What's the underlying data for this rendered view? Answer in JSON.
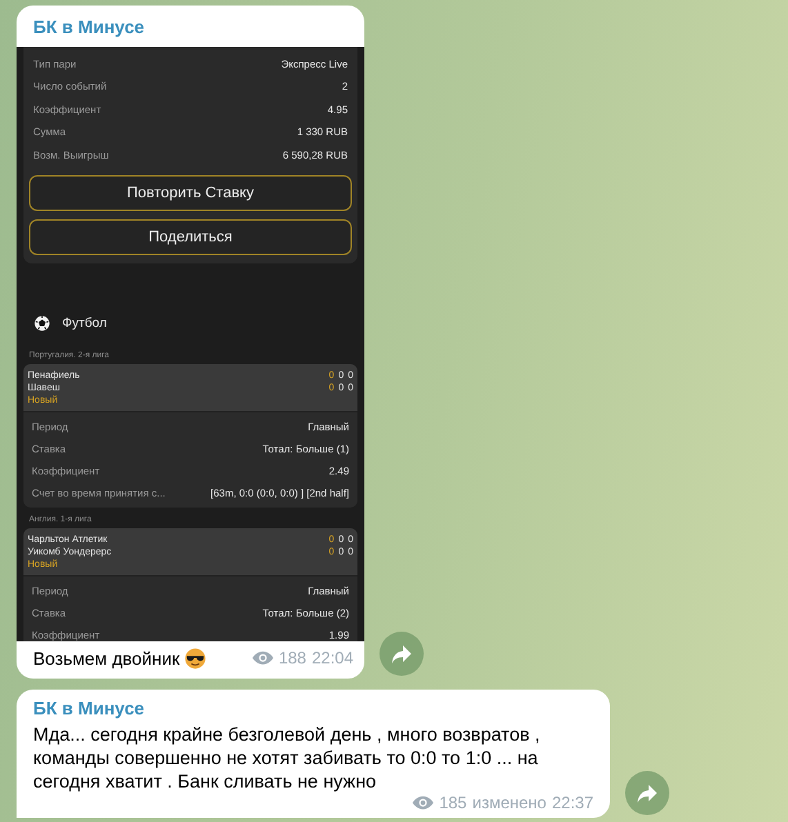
{
  "messages": [
    {
      "kind": "bet",
      "channel": "БК в Минусе",
      "summary": {
        "rows": [
          {
            "label": "Тип пари",
            "value": "Экспресс Live"
          },
          {
            "label": "Число событий",
            "value": "2"
          },
          {
            "label": "Коэффициент",
            "value": "4.95"
          },
          {
            "label": "Сумма",
            "value": "1 330 RUB"
          },
          {
            "label": "Возм. Выигрыш",
            "value": "6 590,28 RUB"
          }
        ],
        "buttons": [
          "Повторить Ставку",
          "Поделиться"
        ]
      },
      "sport": "Футбол",
      "events": [
        {
          "league": "Португалия. 2-я лига",
          "teams": [
            {
              "name": "Пенафиель",
              "scores": [
                "0",
                "0",
                "0"
              ]
            },
            {
              "name": "Шавеш",
              "scores": [
                "0",
                "0",
                "0"
              ]
            }
          ],
          "status": "Новый",
          "details": [
            {
              "label": "Период",
              "value": "Главный"
            },
            {
              "label": "Ставка",
              "value": "Тотал: Больше (1)"
            },
            {
              "label": "Коэффициент",
              "value": "2.49"
            },
            {
              "label": "Счет во время принятия с...",
              "value": "[63m, 0:0 (0:0, 0:0) ] [2nd half]"
            }
          ]
        },
        {
          "league": "Англия. 1-я лига",
          "teams": [
            {
              "name": "Чарльтон Атлетик",
              "scores": [
                "0",
                "0",
                "0"
              ]
            },
            {
              "name": "Уикомб Уондерерс",
              "scores": [
                "0",
                "0",
                "0"
              ]
            }
          ],
          "status": "Новый",
          "details": [
            {
              "label": "Период",
              "value": "Главный"
            },
            {
              "label": "Ставка",
              "value": "Тотал: Больше (2)"
            },
            {
              "label": "Коэффициент",
              "value": "1.99"
            }
          ]
        }
      ],
      "caption": "Возьмем двойник",
      "views": "188",
      "time": "22:04"
    },
    {
      "kind": "text",
      "channel": "БК в Минусе",
      "text": "Мда... сегодня крайне безголевой день , много возвратов , команды совершенно не хотят забивать то 0:0 то 1:0 ... на сегодня хватит . Банк сливать не нужно",
      "views": "185",
      "edited": "изменено",
      "time": "22:37"
    }
  ]
}
